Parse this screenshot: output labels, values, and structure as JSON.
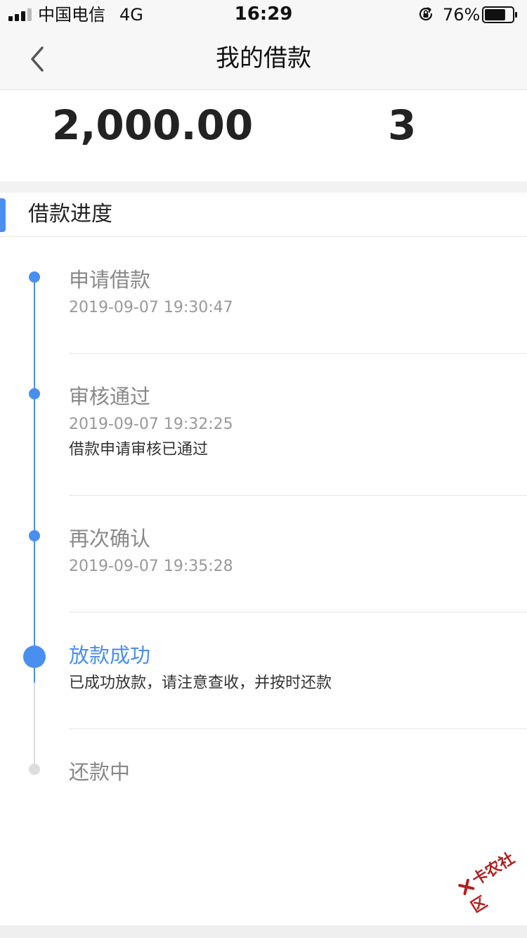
{
  "status_bar": {
    "carrier": "中国电信",
    "network": "4G",
    "time": "16:29",
    "battery_percent": "76%",
    "battery_level": 0.76
  },
  "nav": {
    "title": "我的借款",
    "back_icon": "chevron-left-icon"
  },
  "summary": {
    "amount": "2,000.00",
    "term": "3"
  },
  "section": {
    "title": "借款进度"
  },
  "timeline": {
    "steps": [
      {
        "title": "申请借款",
        "time": "2019-09-07 19:30:47",
        "desc": ""
      },
      {
        "title": "审核通过",
        "time": "2019-09-07 19:32:25",
        "desc": "借款申请审核已通过"
      },
      {
        "title": "再次确认",
        "time": "2019-09-07 19:35:28",
        "desc": ""
      },
      {
        "title": "放款成功",
        "time": "",
        "desc": "已成功放款，请注意查收，并按时还款"
      },
      {
        "title": "还款中",
        "time": "",
        "desc": ""
      }
    ]
  },
  "watermark": {
    "text": "卡农社区"
  },
  "colors": {
    "accent": "#4a8ef0",
    "inactive": "#dddddd"
  }
}
